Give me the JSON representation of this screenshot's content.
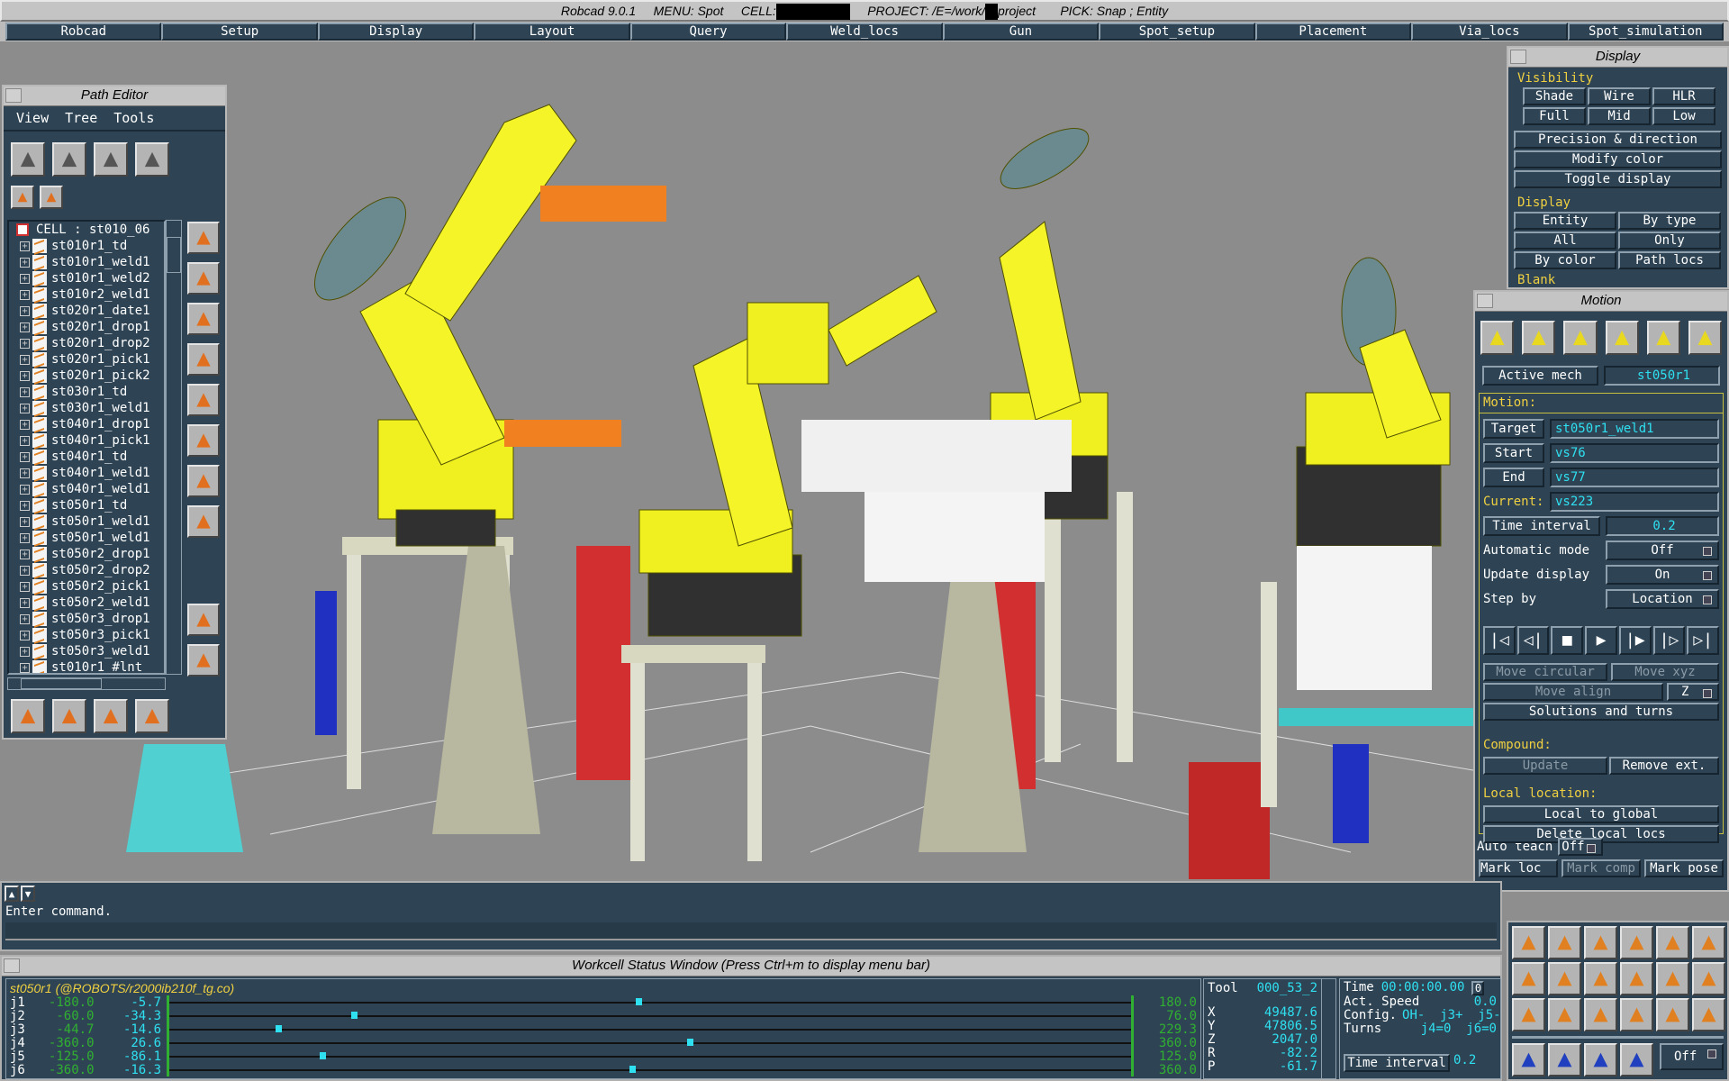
{
  "title": {
    "app": "Robcad 9.0.1",
    "menu": "MENU: Spot",
    "cell": "CELL:",
    "project_a": "PROJECT: /E=/work/",
    "project_b": "project",
    "pick": "PICK: Snap ; Entity"
  },
  "menubar": [
    "Robcad",
    "Setup",
    "Display",
    "Layout",
    "Query",
    "Weld_locs",
    "Gun",
    "Spot_setup",
    "Placement",
    "Via_locs",
    "Spot_simulation"
  ],
  "path_editor": {
    "title": "Path Editor",
    "menu": [
      "View",
      "Tree",
      "Tools"
    ],
    "root": "CELL : st010_06",
    "items": [
      "st010r1_td",
      "st010r1_weld1",
      "st010r1_weld2",
      "st010r2_weld1",
      "st020r1_date1",
      "st020r1_drop1",
      "st020r1_drop2",
      "st020r1_pick1",
      "st020r1_pick2",
      "st030r1_td",
      "st030r1_weld1",
      "st040r1_drop1",
      "st040r1_pick1",
      "st040r1_td",
      "st040r1_weld1",
      "st040r1_weld1",
      "st050r1_td",
      "st050r1_weld1",
      "st050r1_weld1",
      "st050r2_drop1",
      "st050r2_drop2",
      "st050r2_pick1",
      "st050r2_weld1",
      "st050r3_drop1",
      "st050r3_pick1",
      "st050r3_weld1",
      "st010r1_#lnt"
    ],
    "top_icons": [
      "delete-icon",
      "split-path-icon",
      "mirror-path-icon",
      "attach-icon"
    ],
    "small_icons": [
      "add-location-icon",
      "add-multiple-locations-icon"
    ],
    "side_icons": [
      "edit-path-icon",
      "add-to-path-icon",
      "remove-from-path-icon",
      "move-up-icon",
      "move-down-icon",
      "move-path-icon",
      "modify-path-icon",
      "reverse-icon",
      "open-path-icon",
      "save-path-icon"
    ],
    "bottom_icons": [
      "paint-icon",
      "pencil-icon",
      "split-icon",
      "merge-icon"
    ]
  },
  "display_panel": {
    "title": "Display",
    "visibility_label": "Visibility",
    "vis_buttons": [
      "Shade",
      "Wire",
      "HLR",
      "Full",
      "Mid",
      "Low"
    ],
    "wide_buttons": [
      "Precision & direction",
      "Modify color",
      "Toggle display"
    ],
    "display_label": "Display",
    "disp_buttons": [
      "Entity",
      "By type",
      "All",
      "Only",
      "By color",
      "Path locs"
    ],
    "blank_label": "Blank"
  },
  "motion_panel": {
    "title": "Motion",
    "top_icons": [
      "robot-jog-icon",
      "robot-xyz-icon",
      "robot-tool-icon",
      "robot-pose-icon",
      "robot-table-icon",
      "robot-range-icon"
    ],
    "active_mech_label": "Active mech",
    "active_mech": "st050r1",
    "motion_label": "Motion:",
    "target_label": "Target",
    "target": "st050r1_weld1",
    "start_label": "Start",
    "start": "vs76",
    "end_label": "End",
    "end": "vs77",
    "current_label": "Current:",
    "current": "vs223",
    "time_interval_label": "Time interval",
    "time_interval": "0.2",
    "auto_mode_label": "Automatic mode",
    "auto_mode": "Off",
    "update_label": "Update display",
    "update": "On",
    "step_label": "Step by",
    "step": "Location",
    "playback": [
      "first-icon",
      "step-back-icon",
      "stop-icon",
      "play-icon",
      "step-forward-icon",
      "next-icon",
      "last-icon"
    ],
    "move_circular": "Move circular",
    "move_xyz": "Move xyz",
    "move_align": "Move align",
    "align_axis": "Z",
    "solutions": "Solutions and turns",
    "compound_label": "Compound:",
    "update_btn": "Update",
    "remove_ext": "Remove ext.",
    "local_label": "Local location:",
    "local_to_global": "Local to global",
    "delete_local": "Delete local locs",
    "auto_teach_label": "Auto teach",
    "auto_teach": "Off",
    "mark_loc": "Mark loc",
    "mark_comp": "Mark comp",
    "mark_pose": "Mark pose"
  },
  "command": {
    "prompt": "Enter command.",
    "input": ""
  },
  "status_window": {
    "title": "Workcell Status Window  (Press Ctrl+m to display menu bar)",
    "robot": "st050r1 (@ROBOTS/r2000ib210f_tg.co)",
    "joints": [
      {
        "name": "j1",
        "min": "-180.0",
        "value": "-5.7",
        "max": "180.0",
        "v": -5.7,
        "lo": -180,
        "hi": 180
      },
      {
        "name": "j2",
        "min": "-60.0",
        "value": "-34.3",
        "max": "76.0",
        "v": -34.3,
        "lo": -60,
        "hi": 76
      },
      {
        "name": "j3",
        "min": "-44.7",
        "value": "-14.6",
        "max": "229.3",
        "v": -14.6,
        "lo": -44.7,
        "hi": 229.3
      },
      {
        "name": "j4",
        "min": "-360.0",
        "value": "26.6",
        "max": "360.0",
        "v": 26.6,
        "lo": -360,
        "hi": 360
      },
      {
        "name": "j5",
        "min": "-125.0",
        "value": "-86.1",
        "max": "125.0",
        "v": -86.1,
        "lo": -125,
        "hi": 125
      },
      {
        "name": "j6",
        "min": "-360.0",
        "value": "-16.3",
        "max": "360.0",
        "v": -16.3,
        "lo": -360,
        "hi": 360
      }
    ],
    "tool_label": "Tool",
    "tool": "000_53_2",
    "coords": [
      {
        "axis": "X",
        "value": "49487.6"
      },
      {
        "axis": "Y",
        "value": "47806.5"
      },
      {
        "axis": "Z",
        "value": "2047.0"
      },
      {
        "axis": "R",
        "value": "-82.2"
      },
      {
        "axis": "P",
        "value": "-61.7"
      }
    ],
    "time_label": "Time",
    "time": "00:00:00.00",
    "time_btn": "0",
    "speed_label": "Act. Speed",
    "speed": "0.0",
    "config_label": "Config.",
    "config": "OH-  j3+  j5-",
    "turns_label": "Turns",
    "turns": "j4=0  j6=0",
    "ti_label": "Time interval",
    "ti": "0.2"
  },
  "toolbox": {
    "icons": [
      "spreadsheet-icon",
      "cabinet-icon",
      "table-zoom-icon",
      "zoom-frame-icon",
      "box-face-icon",
      "pencil-frame-icon",
      "wand-icon",
      "hierarchy-icon",
      "robot-color-icon",
      "flag-icon",
      "robot-dark-icon",
      "axes-icon",
      "path-icon",
      "layers-icon",
      "table-pencil-icon",
      "flower-pencil-icon",
      "robot-table-icon",
      "table-link-icon"
    ],
    "bottom_icons": [
      "rotate-icon",
      "target-icon",
      "undo-icon",
      "robot-range-icon"
    ],
    "toggle": "Off"
  },
  "colors": {
    "panel": "#2e4455",
    "label": "#f0d040",
    "value": "#2ee0f0",
    "limit": "#30b030",
    "viewport": "#8c8c8c"
  }
}
